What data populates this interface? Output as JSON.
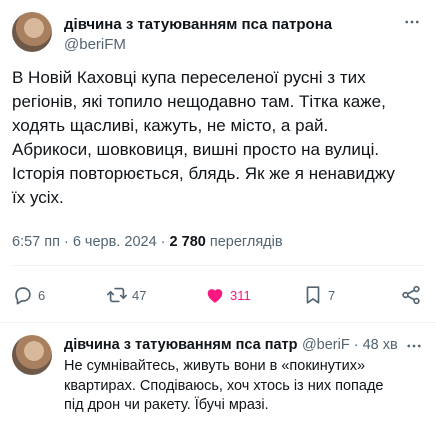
{
  "main_tweet": {
    "author_name": "дівчина з татуюванням пса патрона",
    "author_handle": "@beriFM",
    "text": "В Новій Каховці купа переселеної русні з тих\nрегіонів, які топило нещодавно там. Тітка каже,\nходять щасливі, кажуть, не місто, а рай.\nАбрикоси, шовковиця, вишні просто на вулиці.\nІсторія повторюється, блядь. Як же я ненавиджу\nїх усіх.",
    "time": "6:57 пп · 6 черв. 2024 · ",
    "views_count": "2 780",
    "views_label": " переглядів",
    "stats": {
      "replies": "6",
      "retweets": "47",
      "likes": "311",
      "bookmarks": "7"
    }
  },
  "reply_tweet": {
    "author_name": "дівчина з татуюванням пса патр",
    "author_handle": "@beriF",
    "separator": " · ",
    "time": "48 хв",
    "text": "Не сумнівайтесь, живуть вони в «покинутих»\nквартирах. Сподіваюсь, хоч хтось із них попаде\nпід дрон чи ракету. Їбучі мразі."
  },
  "icons": {
    "more": "more-horizontal-icon",
    "reply": "reply-icon",
    "retweet": "retweet-icon",
    "like": "heart-filled-icon",
    "bookmark": "bookmark-icon",
    "share": "share-icon"
  },
  "colors": {
    "like_active": "#f91880",
    "secondary_text": "#536471",
    "primary_text": "#0f1419"
  }
}
